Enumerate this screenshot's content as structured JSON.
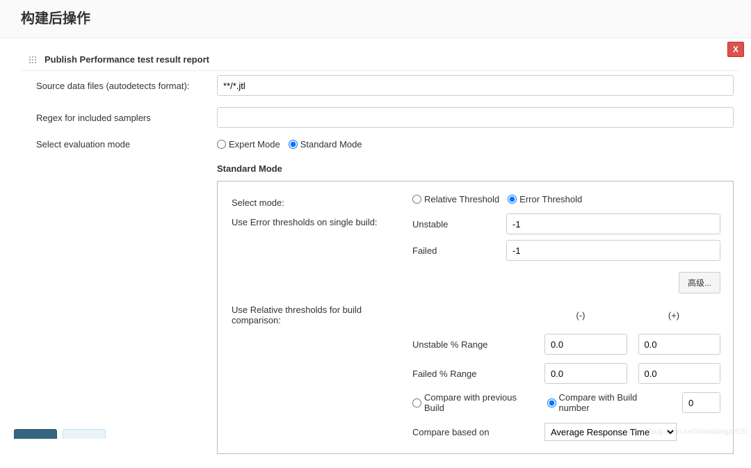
{
  "pageTitle": "构建后操作",
  "closeBtn": "X",
  "section": {
    "title": "Publish Performance test result report",
    "fields": {
      "sourceFilesLabel": "Source data files (autodetects format):",
      "sourceFilesValue": "**/*.jtl",
      "regexLabel": "Regex for included samplers",
      "regexValue": "",
      "evalModeLabel": "Select evaluation mode",
      "evalModeOptions": {
        "expert": "Expert Mode",
        "standard": "Standard Mode"
      },
      "evalModeSelected": "standard"
    },
    "standardMode": {
      "heading": "Standard Mode",
      "selectModeLabel": "Select mode:",
      "selectModeOptions": {
        "relative": "Relative Threshold",
        "error": "Error Threshold"
      },
      "selectModeSelected": "error",
      "errorThresholdsLabel": "Use Error thresholds on single build:",
      "unstableLabel": "Unstable",
      "unstableValue": "-1",
      "failedLabel": "Failed",
      "failedValue": "-1",
      "advancedBtn": "高级...",
      "relativeThresholdsLabel": "Use Relative thresholds for build comparison:",
      "minusHeader": "(-)",
      "plusHeader": "(+)",
      "unstableRangeLabel": "Unstable % Range",
      "unstableRangeMinus": "0.0",
      "unstableRangePlus": "0.0",
      "failedRangeLabel": "Failed % Range",
      "failedRangeMinus": "0.0",
      "failedRangePlus": "0.0",
      "compareOptions": {
        "previous": "Compare with previous Build",
        "number": "Compare with Build number"
      },
      "compareSelected": "number",
      "compareNumberValue": "0",
      "compareBasedLabel": "Compare based on",
      "compareBasedSelected": "Average Response Time"
    }
  },
  "watermark": "https://blog.csdn.net/xiaoxiangzi520"
}
